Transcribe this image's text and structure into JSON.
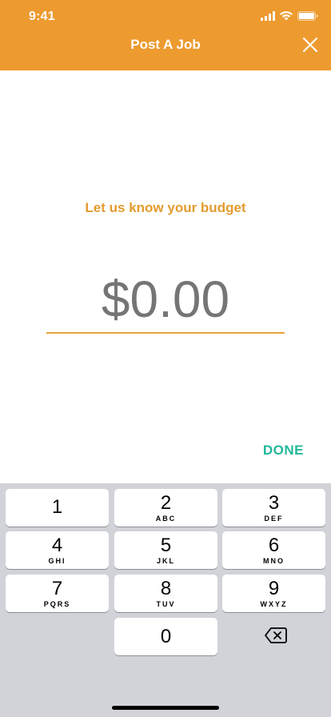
{
  "status_bar": {
    "time": "9:41"
  },
  "header": {
    "title": "Post A Job",
    "close_icon": "close-icon",
    "color": "#ED9A2F"
  },
  "budget": {
    "prompt": "Let us know your budget",
    "placeholder": "$0.00",
    "value": ""
  },
  "actions": {
    "done_label": "DONE",
    "done_color": "#22B89A"
  },
  "keypad": {
    "keys": [
      {
        "digit": "1",
        "letters": ""
      },
      {
        "digit": "2",
        "letters": "ABC"
      },
      {
        "digit": "3",
        "letters": "DEF"
      },
      {
        "digit": "4",
        "letters": "GHI"
      },
      {
        "digit": "5",
        "letters": "JKL"
      },
      {
        "digit": "6",
        "letters": "MNO"
      },
      {
        "digit": "7",
        "letters": "PQRS"
      },
      {
        "digit": "8",
        "letters": "TUV"
      },
      {
        "digit": "9",
        "letters": "WXYZ"
      },
      {
        "digit": "0",
        "letters": ""
      }
    ],
    "backspace_icon": "backspace-icon"
  }
}
